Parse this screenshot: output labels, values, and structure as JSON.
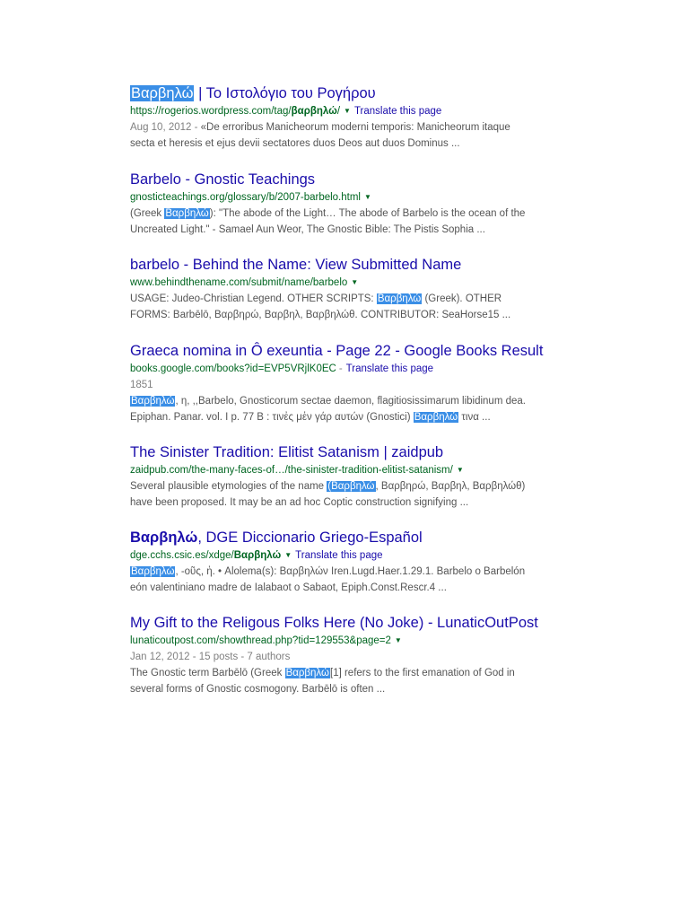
{
  "hl_term": "Βαρβηλώ",
  "hl_term_paren": "(Βαρβηλώ",
  "translate_label": "Translate this page",
  "r1": {
    "title_rest": " | Το Ιστολόγιο του Ρογήρου",
    "url_pre": "https://rogerios.wordpress.com/tag/",
    "url_bold": "βαρβηλώ",
    "url_post": "/",
    "date": "Aug 10, 2012 - ",
    "line1_rest": "«De erroribus Manicheorum moderni temporis: Manicheorum itaque",
    "line2": "secta et heresis et ejus devii sectatores duos Deos aut duos Dominus ..."
  },
  "r2": {
    "title": "Barbelo - Gnostic Teachings",
    "url": "gnosticteachings.org/glossary/b/2007-barbelo.html",
    "line1_pre": "(Greek ",
    "line1_post": "): \"The abode of the Light… The abode of Barbelo is the ocean of the",
    "line2": "Uncreated Light.\" - Samael Aun Weor, The Gnostic Bible: The Pistis Sophia ..."
  },
  "r3": {
    "title": "barbelo - Behind the Name: View Submitted Name",
    "url": "www.behindthename.com/submit/name/barbelo",
    "line1_pre": "USAGE: Judeo-Christian Legend. OTHER SCRIPTS: ",
    "line1_post": " (Greek). OTHER",
    "line2": "FORMS: Barbēlō, Βαρβηρώ, Βαρβηλ, Βαρβηλώθ. CONTRIBUTOR: SeaHorse15 ..."
  },
  "r4": {
    "title": "Graeca nomina in Ô exeuntia - Page 22 - Google Books Result",
    "url": "books.google.com/books?id=EVP5VRjlK0EC",
    "sep": "-",
    "year": "1851",
    "line2_post": ", η, ,,Barbelo, Gnosticorum sectae daemon, flagitiosissimarum libidinum dea.",
    "line3_pre": "Epiphan. Panar. vol. I p. 77 B : τινἐς μἐν γάρ αυτών (Gnostici) ",
    "line3_post": " τινα ..."
  },
  "r5": {
    "title": "The Sinister Tradition: Elitist Satanism | zaidpub",
    "url": "zaidpub.com/the-many-faces-of…/the-sinister-tradition-elitist-satanism/",
    "line1_pre": "Several plausible etymologies of the name ",
    "line1_post": ", Βαρβηρώ, Βαρβηλ, Βαρβηλώθ)",
    "line2": "have been proposed. It may be an ad hoc Coptic construction signifying ..."
  },
  "r6": {
    "title_rest": ", DGE Diccionario Griego-Español",
    "url_pre": "dge.cchs.csic.es/xdge/",
    "url_bold": "Βαρβηλώ",
    "line1_post": ", -οῦς, ἡ. • Alolema(s): Βαρβηλών Iren.Lugd.Haer.1.29.1. Barbelo o Barbelón",
    "line2": "eón valentiniano madre de Ialabaot o Sabaot, Epiph.Const.Rescr.4 ..."
  },
  "r7": {
    "title": "My Gift to the Religous Folks Here (No Joke) - LunaticOutPost",
    "url": "lunaticoutpost.com/showthread.php?tid=129553&page=2",
    "date": "Jan 12, 2012 - 15 posts - 7 authors",
    "line1_pre": "The Gnostic term Barbēlō (Greek ",
    "line1_post": "[1] refers to the first emanation of God in",
    "line2": "several forms of Gnostic cosmogony. Barbēlō is often ..."
  }
}
